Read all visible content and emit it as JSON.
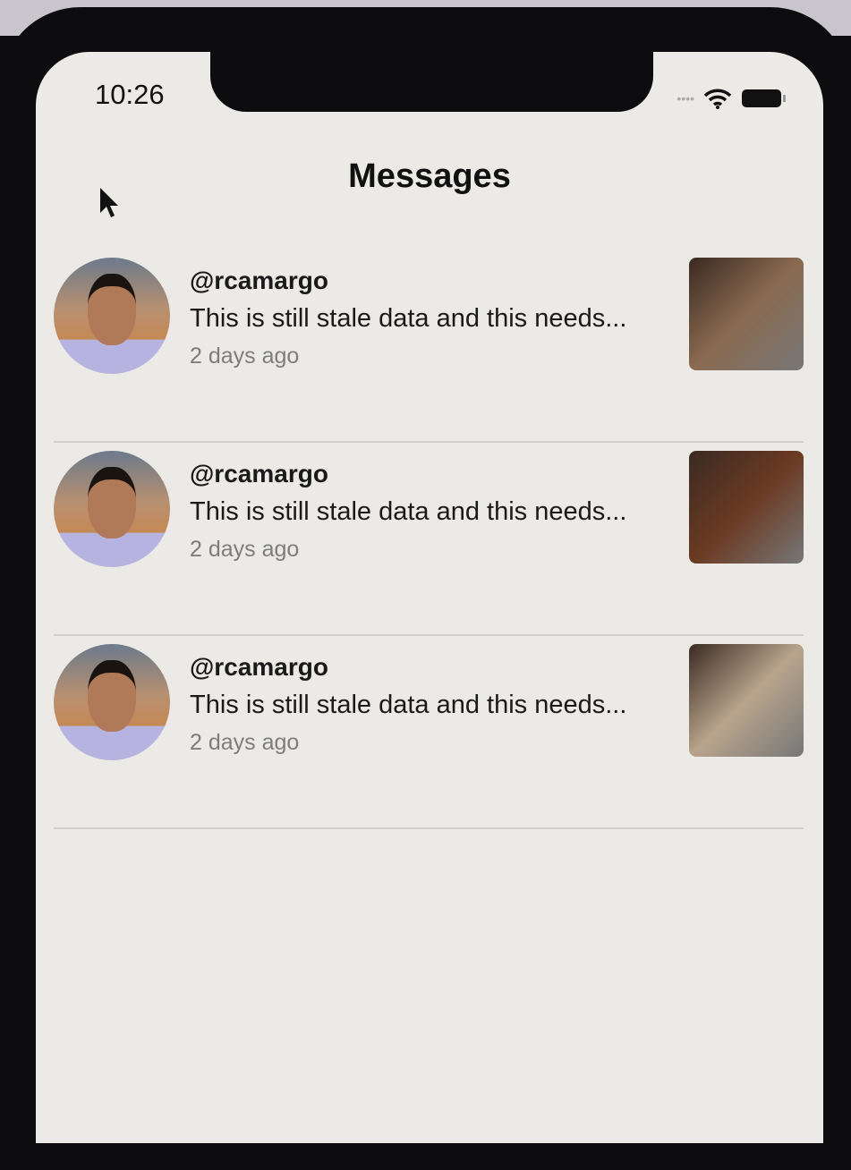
{
  "status": {
    "time": "10:26"
  },
  "header": {
    "title": "Messages"
  },
  "messages": [
    {
      "user": "@rcamargo",
      "text": "This is still stale data and this needs...",
      "time": "2 days ago",
      "thumb_color": "#8a6a50"
    },
    {
      "user": "@rcamargo",
      "text": "This is still stale data and this needs...",
      "time": "2 days ago",
      "thumb_color": "#6b3a22"
    },
    {
      "user": "@rcamargo",
      "text": "This is still stale data and this needs...",
      "time": "2 days ago",
      "thumb_color": "#b8a48c"
    }
  ]
}
